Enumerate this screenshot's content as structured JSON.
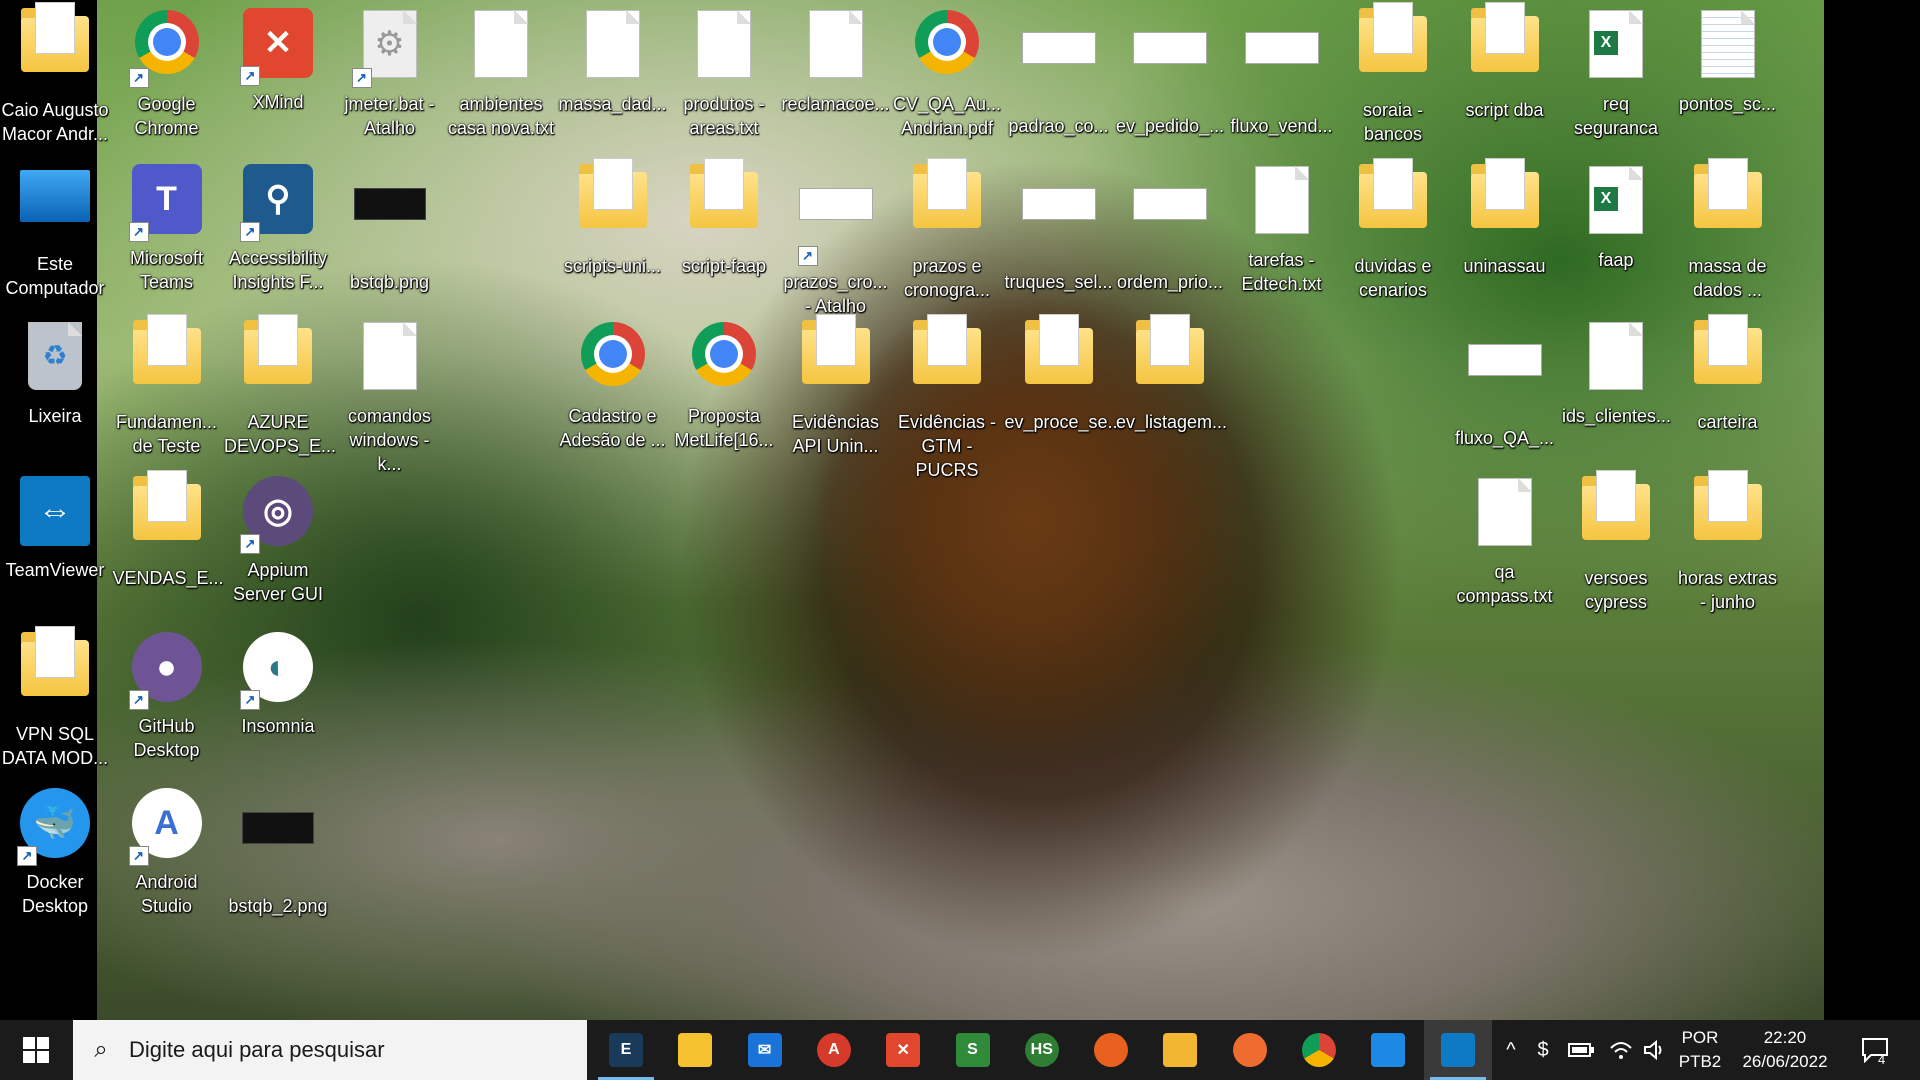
{
  "desktop": {
    "icons": [
      {
        "label": "Caio Augusto Macor Andr...",
        "icon": "user-folder-icon"
      },
      {
        "label": "Google Chrome",
        "icon": "chrome-icon"
      },
      {
        "label": "XMind",
        "icon": "xmind-icon"
      },
      {
        "label": "jmeter.bat - Atalho",
        "icon": "gear-shortcut-icon"
      },
      {
        "label": "ambientes casa nova.txt",
        "icon": "text-file-icon"
      },
      {
        "label": "massa_dad...",
        "icon": "text-file-icon"
      },
      {
        "label": "produtos - areas.txt",
        "icon": "text-file-icon"
      },
      {
        "label": "reclamacoe...",
        "icon": "text-file-icon"
      },
      {
        "label": "CV_QA_Au... Andrian.pdf",
        "icon": "chrome-pdf-icon"
      },
      {
        "label": "padrao_co...",
        "icon": "image-file-icon"
      },
      {
        "label": "ev_pedido_...",
        "icon": "image-file-icon"
      },
      {
        "label": "fluxo_vend...",
        "icon": "image-file-icon"
      },
      {
        "label": "soraia - bancos",
        "icon": "folder-icon"
      },
      {
        "label": "script dba",
        "icon": "folder-icon"
      },
      {
        "label": "req seguranca",
        "icon": "excel-file-icon"
      },
      {
        "label": "pontos_sc...",
        "icon": "spreadsheet-file-icon"
      },
      {
        "label": "Este Computador",
        "icon": "computer-icon"
      },
      {
        "label": "Microsoft Teams",
        "icon": "teams-icon"
      },
      {
        "label": "Accessibility Insights F...",
        "icon": "accessibility-insights-icon"
      },
      {
        "label": "bstqb.png",
        "icon": "image-file-icon"
      },
      {
        "label": "scripts-uni...",
        "icon": "folder-icon"
      },
      {
        "label": "script-faap",
        "icon": "folder-icon"
      },
      {
        "label": "prazos_cro... - Atalho",
        "icon": "image-shortcut-icon"
      },
      {
        "label": "prazos e cronogra...",
        "icon": "folder-icon"
      },
      {
        "label": "truques_sel...",
        "icon": "image-file-icon"
      },
      {
        "label": "ordem_prio...",
        "icon": "image-file-icon"
      },
      {
        "label": "tarefas - Edtech.txt",
        "icon": "text-file-icon"
      },
      {
        "label": "duvidas e cenarios",
        "icon": "folder-icon"
      },
      {
        "label": "uninassau",
        "icon": "folder-icon"
      },
      {
        "label": "faap",
        "icon": "excel-file-icon"
      },
      {
        "label": "massa de dados ...",
        "icon": "folder-icon"
      },
      {
        "label": "Lixeira",
        "icon": "recycle-bin-icon"
      },
      {
        "label": "Fundamen... de Teste",
        "icon": "folder-icon"
      },
      {
        "label": "AZURE DEVOPS_E...",
        "icon": "folder-icon"
      },
      {
        "label": "comandos windows - k...",
        "icon": "text-file-icon"
      },
      {
        "label": "Cadastro e Adesão de ...",
        "icon": "chrome-pdf-icon"
      },
      {
        "label": "Proposta MetLife[16...",
        "icon": "chrome-pdf-icon"
      },
      {
        "label": "Evidências API Unin...",
        "icon": "folder-icon"
      },
      {
        "label": "Evidências - GTM - PUCRS",
        "icon": "folder-icon"
      },
      {
        "label": "ev_proce_se...",
        "icon": "folder-icon"
      },
      {
        "label": "ev_listagem...",
        "icon": "folder-icon"
      },
      {
        "label": "fluxo_QA_...",
        "icon": "image-file-icon"
      },
      {
        "label": "ids_clientes...",
        "icon": "text-file-icon"
      },
      {
        "label": "carteira",
        "icon": "folder-icon"
      },
      {
        "label": "TeamViewer",
        "icon": "teamviewer-icon"
      },
      {
        "label": "VENDAS_E...",
        "icon": "folder-icon"
      },
      {
        "label": "Appium Server GUI",
        "icon": "appium-icon"
      },
      {
        "label": "qa compass.txt",
        "icon": "text-file-icon"
      },
      {
        "label": "versoes cypress",
        "icon": "folder-icon"
      },
      {
        "label": "horas extras - junho",
        "icon": "folder-icon"
      },
      {
        "label": "VPN SQL DATA MOD...",
        "icon": "folder-icon"
      },
      {
        "label": "GitHub Desktop",
        "icon": "github-icon"
      },
      {
        "label": "Insomnia",
        "icon": "insomnia-icon"
      },
      {
        "label": "Docker Desktop",
        "icon": "docker-icon"
      },
      {
        "label": "Android Studio",
        "icon": "android-studio-icon"
      },
      {
        "label": "bstqb_2.png",
        "icon": "image-file-icon"
      }
    ]
  },
  "taskbar": {
    "start_icon": "windows-start-icon",
    "search_placeholder": "Digite aqui para pesquisar",
    "pinned": [
      {
        "name": "eclipse-icon",
        "label": "E",
        "color": "#1a3a5a"
      },
      {
        "name": "sticky-notes-icon",
        "label": "",
        "color": "#f7c22f"
      },
      {
        "name": "mail-icon",
        "label": "✉",
        "color": "#1a73d8"
      },
      {
        "name": "jmeter-icon",
        "label": "A",
        "color": "#d63a2a"
      },
      {
        "name": "xmind-icon",
        "label": "✕",
        "color": "#e0472e"
      },
      {
        "name": "dbeaver-icon",
        "label": "S",
        "color": "#2f8a3a"
      },
      {
        "name": "hs-icon",
        "label": "HS",
        "color": "#2e7d32"
      },
      {
        "name": "firefox-icon",
        "label": "",
        "color": "#e8611e"
      },
      {
        "name": "file-explorer-icon",
        "label": "",
        "color": "#f2b632"
      },
      {
        "name": "postman-icon",
        "label": "",
        "color": "#ef6c30"
      },
      {
        "name": "chrome-icon",
        "label": "",
        "color": "#4285f4"
      },
      {
        "name": "vscode-icon",
        "label": "",
        "color": "#1e88e5"
      },
      {
        "name": "teamviewer-icon",
        "label": "",
        "color": "#0e7ac4"
      }
    ],
    "tray": {
      "chevron": "^",
      "language_top": "POR",
      "language_bottom": "PTB2",
      "time": "22:20",
      "date": "26/06/2022",
      "notifications": "4"
    }
  }
}
